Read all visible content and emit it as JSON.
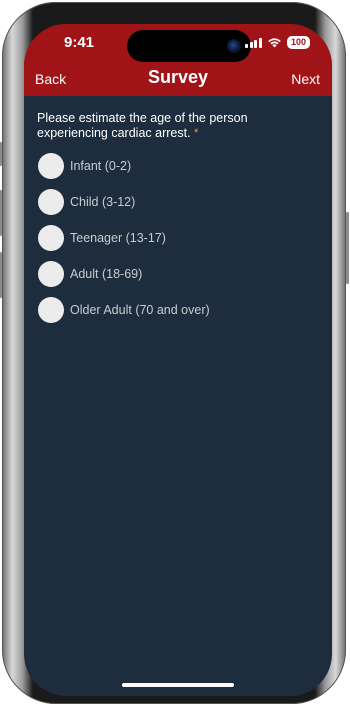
{
  "status_bar": {
    "time": "9:41",
    "battery": "100"
  },
  "nav": {
    "back_label": "Back",
    "title": "Survey",
    "next_label": "Next"
  },
  "question": {
    "text": "Please estimate the age of the person experiencing cardiac arrest.",
    "required_marker": "*"
  },
  "options": [
    {
      "label": "Infant (0-2)"
    },
    {
      "label": "Child (3-12)"
    },
    {
      "label": "Teenager (13-17)"
    },
    {
      "label": "Adult (18-69)"
    },
    {
      "label": "Older Adult (70 and over)"
    }
  ],
  "colors": {
    "header": "#a01418",
    "background": "#1d2d3d",
    "radio": "#ececec",
    "required": "#f0a030"
  }
}
